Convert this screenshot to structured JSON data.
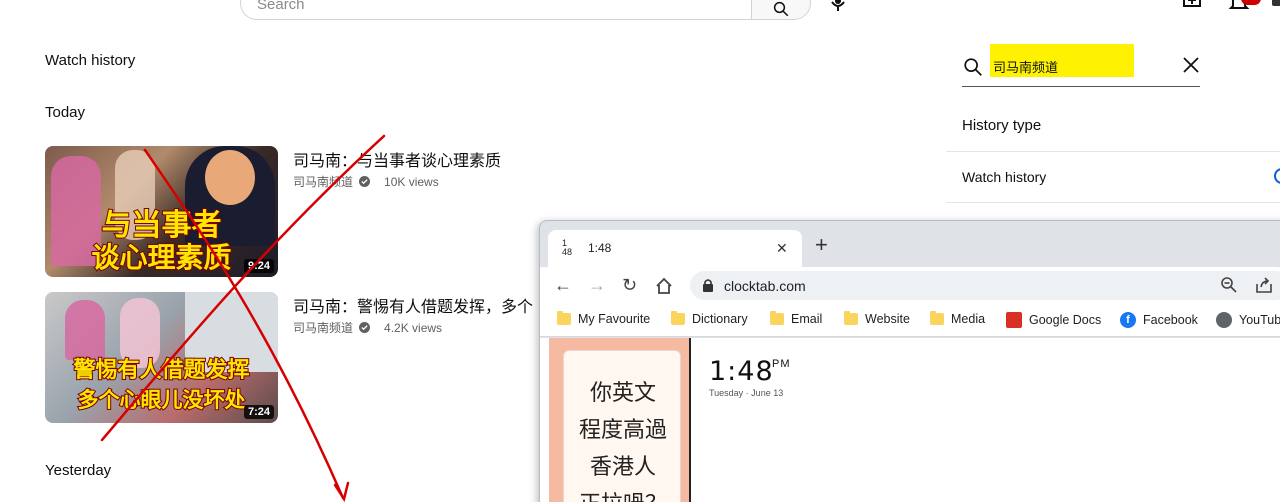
{
  "topbar": {
    "search_placeholder": "Search",
    "icons": [
      "search-icon",
      "mic-icon",
      "create-icon",
      "bell-icon"
    ]
  },
  "page": {
    "title": "Watch history",
    "sections": {
      "today": "Today",
      "yesterday": "Yesterday"
    }
  },
  "videos": [
    {
      "title": "司马南：与当事者谈心理素质",
      "channel": "司马南频道",
      "views": "10K views",
      "duration": "9:24",
      "thumb_caption_1": "与当事者",
      "thumb_caption_2": "谈心理素质"
    },
    {
      "title": "司马南：警惕有人借题发挥，多个",
      "channel": "司马南频道",
      "views": "4.2K views",
      "duration": "7:24",
      "thumb_caption_1": "警惕有人借题发挥",
      "thumb_caption_2": "多个心眼儿没坏处"
    }
  ],
  "filter_panel": {
    "search_value": "司马南频道",
    "history_type_label": "History type",
    "option_watch_history": "Watch history",
    "highlight_color": "#fff200"
  },
  "browser": {
    "tab_favicon_top": "1",
    "tab_favicon_bottom": "48",
    "tab_title": "1:48",
    "url": "clocktab.com",
    "bookmarks": [
      "My Favourite",
      "Dictionary",
      "Email",
      "Website",
      "Media",
      "Google Docs",
      "Facebook",
      "YouTube"
    ],
    "image_text": [
      "你英文",
      "程度高過",
      "香港人",
      "正拉喎？"
    ],
    "clock_time": "1:48",
    "clock_ampm": "PM",
    "clock_date": "Tuesday · June 13"
  },
  "colors": {
    "annotation_red": "#d60000",
    "accent_blue": "#065fd4"
  }
}
